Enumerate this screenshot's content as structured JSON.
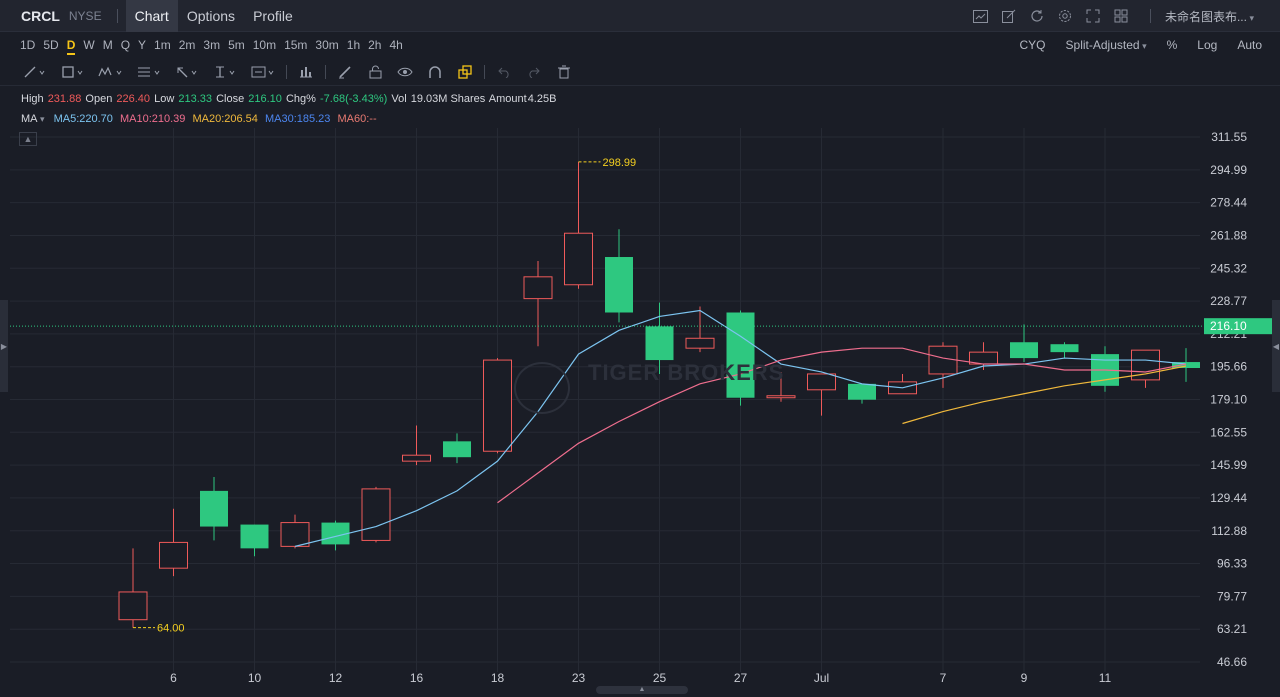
{
  "header": {
    "ticker": "CRCL",
    "exchange": "NYSE",
    "tabs": [
      {
        "label": "Chart",
        "active": true
      },
      {
        "label": "Options",
        "active": false
      },
      {
        "label": "Profile",
        "active": false
      }
    ],
    "layout_name": "未命名图表布...",
    "icons": [
      "chart-type-icon",
      "draw-pen-icon",
      "refresh-icon",
      "settings-icon",
      "fullscreen-icon",
      "layout-grid-icon"
    ]
  },
  "periods": {
    "items": [
      "1D",
      "5D",
      "D",
      "W",
      "M",
      "Q",
      "Y",
      "1m",
      "2m",
      "3m",
      "5m",
      "10m",
      "15m",
      "30m",
      "1h",
      "2h",
      "4h"
    ],
    "active": "D",
    "right": {
      "cyq": "CYQ",
      "adjust": "Split-Adjusted",
      "percent": "%",
      "log": "Log",
      "auto": "Auto"
    }
  },
  "tools": [
    "line-tool-icon",
    "rectangle-tool-icon",
    "pattern-tool-icon",
    "fib-tool-icon",
    "arrow-tool-icon",
    "text-tool-icon",
    "annotation-tool-icon",
    "measure-icon",
    "pencil-icon",
    "lock-icon",
    "eye-icon",
    "magnet-icon",
    "stack-icon",
    "undo-icon",
    "redo-icon",
    "trash-icon"
  ],
  "ohlc": {
    "high_label": "High",
    "high": "231.88",
    "open_label": "Open",
    "open": "226.40",
    "low_label": "Low",
    "low": "213.33",
    "close_label": "Close",
    "close": "216.10",
    "chg_label": "Chg%",
    "chg": "-7.68(-3.43%)",
    "vol_label": "Vol",
    "vol": "19.03M Shares",
    "amount_label": "Amount",
    "amount": "4.25B"
  },
  "ma": {
    "label": "MA",
    "ma5": "MA5:220.70",
    "ma10": "MA10:210.39",
    "ma20": "MA20:206.54",
    "ma30": "MA30:185.23",
    "ma60": "MA60:--"
  },
  "watermark": "TIGER BROKERS",
  "chart_data": {
    "type": "candlestick",
    "y_ticks": [
      "311.55",
      "294.99",
      "278.44",
      "261.88",
      "245.32",
      "228.77",
      "212.21",
      "195.66",
      "179.10",
      "162.55",
      "145.99",
      "129.44",
      "112.88",
      "96.33",
      "79.77",
      "63.21",
      "46.66"
    ],
    "ylim": [
      46.66,
      311.55
    ],
    "x_ticks": [
      "6",
      "10",
      "12",
      "16",
      "18",
      "23",
      "25",
      "27",
      "Jul",
      "7",
      "9",
      "11"
    ],
    "last_price": "216.10",
    "annotations": [
      {
        "label": "298.99",
        "value": 298.99,
        "type": "high"
      },
      {
        "label": "64.00",
        "value": 64.0,
        "type": "low"
      }
    ],
    "candles": [
      {
        "date": "Jun 5",
        "o": 68,
        "h": 104,
        "l": 64,
        "c": 82
      },
      {
        "date": "Jun 6",
        "o": 94,
        "h": 124,
        "l": 90,
        "c": 107
      },
      {
        "date": "Jun 9",
        "o": 133,
        "h": 140,
        "l": 108,
        "c": 115
      },
      {
        "date": "Jun 10",
        "o": 116,
        "h": 116,
        "l": 100,
        "c": 104
      },
      {
        "date": "Jun 11",
        "o": 105,
        "h": 121,
        "l": 104,
        "c": 117
      },
      {
        "date": "Jun 12",
        "o": 117,
        "h": 118,
        "l": 103,
        "c": 106
      },
      {
        "date": "Jun 13",
        "o": 108,
        "h": 135,
        "l": 107,
        "c": 134
      },
      {
        "date": "Jun 16",
        "o": 148,
        "h": 166,
        "l": 146,
        "c": 151
      },
      {
        "date": "Jun 17",
        "o": 158,
        "h": 162,
        "l": 147,
        "c": 150
      },
      {
        "date": "Jun 18",
        "o": 153,
        "h": 200,
        "l": 152,
        "c": 199
      },
      {
        "date": "Jun 20",
        "o": 230,
        "h": 249,
        "l": 206,
        "c": 241
      },
      {
        "date": "Jun 23",
        "o": 237,
        "h": 299,
        "l": 235,
        "c": 263
      },
      {
        "date": "Jun 24",
        "o": 251,
        "h": 265,
        "l": 218,
        "c": 223
      },
      {
        "date": "Jun 25",
        "o": 216,
        "h": 228,
        "l": 192,
        "c": 199
      },
      {
        "date": "Jun 26",
        "o": 205,
        "h": 226,
        "l": 203,
        "c": 210
      },
      {
        "date": "Jun 27",
        "o": 223,
        "h": 224,
        "l": 176,
        "c": 180
      },
      {
        "date": "Jun 30",
        "o": 180,
        "h": 193,
        "l": 178,
        "c": 181
      },
      {
        "date": "Jul 1",
        "o": 184,
        "h": 192,
        "l": 171,
        "c": 192
      },
      {
        "date": "Jul 2",
        "o": 187,
        "h": 187,
        "l": 177,
        "c": 179
      },
      {
        "date": "Jul 3",
        "o": 182,
        "h": 192,
        "l": 182,
        "c": 188
      },
      {
        "date": "Jul 7",
        "o": 192,
        "h": 208,
        "l": 185,
        "c": 206
      },
      {
        "date": "Jul 8",
        "o": 197,
        "h": 208,
        "l": 194,
        "c": 203
      },
      {
        "date": "Jul 9",
        "o": 208,
        "h": 217,
        "l": 198,
        "c": 200
      },
      {
        "date": "Jul 10",
        "o": 207,
        "h": 208,
        "l": 200,
        "c": 203
      },
      {
        "date": "Jul 11",
        "o": 202,
        "h": 206,
        "l": 183,
        "c": 186
      },
      {
        "date": "Jul 14",
        "o": 189,
        "h": 204,
        "l": 185,
        "c": 204
      },
      {
        "date": "Jul 15",
        "o": 198,
        "h": 205,
        "l": 188,
        "c": 195
      }
    ],
    "ma_lines": [
      {
        "name": "MA5",
        "color": "#7cc4f0",
        "values": [
          null,
          null,
          null,
          null,
          105,
          110,
          115,
          123,
          133,
          148,
          173,
          202,
          214,
          221,
          224,
          211,
          197,
          193,
          187,
          185,
          190,
          196,
          197,
          200,
          199,
          199,
          197
        ]
      },
      {
        "name": "MA10",
        "color": "#ef6e8e",
        "values": [
          null,
          null,
          null,
          null,
          null,
          null,
          null,
          null,
          null,
          127,
          142,
          157,
          168,
          178,
          187,
          192,
          199,
          203,
          205,
          205,
          200,
          197,
          197,
          194,
          194,
          193,
          197
        ]
      },
      {
        "name": "MA20",
        "color": "#f0b93c",
        "values": [
          null,
          null,
          null,
          null,
          null,
          null,
          null,
          null,
          null,
          null,
          null,
          null,
          null,
          null,
          null,
          null,
          null,
          null,
          null,
          167,
          173,
          178,
          182,
          186,
          189,
          192,
          196
        ]
      }
    ],
    "colors": {
      "up": "#ef5a5a",
      "down": "#2ec880",
      "background": "#1a1d26",
      "grid": "#262a34",
      "axis_text": "#c9ccd4",
      "annotation": "#f5d020",
      "last_price_bg": "#2ec880"
    }
  }
}
